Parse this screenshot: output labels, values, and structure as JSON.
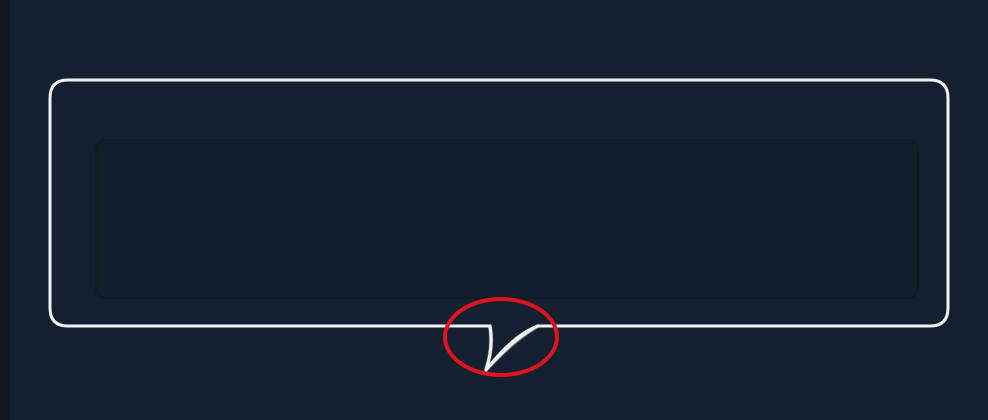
{
  "speech_bubble": {
    "text": "",
    "border_color": "#f2f2f2",
    "fill_color": "#14202f",
    "inner_outline_color": "#101a26"
  },
  "annotation": {
    "shape": "ellipse",
    "color": "#e0141e",
    "target": "speech-bubble-tail"
  },
  "colors": {
    "background": "#14202f",
    "left_edge": "#0f1823"
  }
}
